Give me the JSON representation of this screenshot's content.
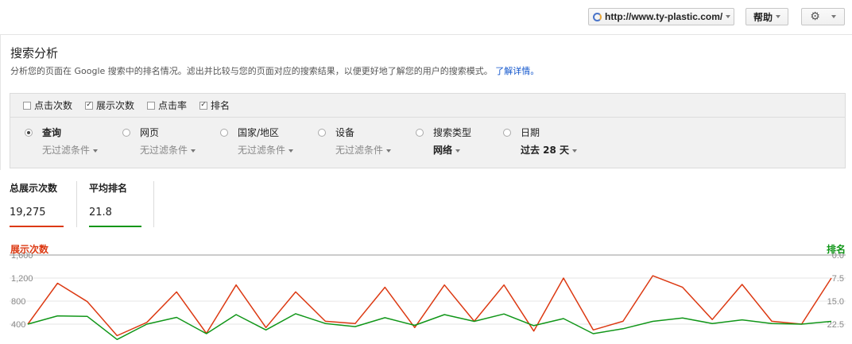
{
  "header": {
    "site": "http://www.ty-plastic.com/",
    "help_label": "帮助",
    "settings_icon": "gear-icon"
  },
  "page": {
    "title": "搜索分析",
    "description": "分析您的页面在 Google 搜索中的排名情况。滤出并比较与您的页面对应的搜索结果，以便更好地了解您的用户的搜索模式。",
    "learn_more": "了解详情。"
  },
  "metrics": [
    {
      "label": "点击次数",
      "checked": false
    },
    {
      "label": "展示次数",
      "checked": true
    },
    {
      "label": "点击率",
      "checked": false
    },
    {
      "label": "排名",
      "checked": true
    }
  ],
  "dimensions": [
    {
      "label": "查询",
      "value": "无过滤条件",
      "selected": true
    },
    {
      "label": "网页",
      "value": "无过滤条件",
      "selected": false
    },
    {
      "label": "国家/地区",
      "value": "无过滤条件",
      "selected": false
    },
    {
      "label": "设备",
      "value": "无过滤条件",
      "selected": false
    },
    {
      "label": "搜索类型",
      "value": "网络",
      "selected": false
    },
    {
      "label": "日期",
      "value": "过去 28 天",
      "selected": false
    }
  ],
  "totals": [
    {
      "label": "总展示次数",
      "value": "19,275",
      "color": "#dc3912"
    },
    {
      "label": "平均排名",
      "value": "21.8",
      "color": "#109618"
    }
  ],
  "chart_data": {
    "type": "line",
    "left_axis_label": "展示次数",
    "right_axis_label": "排名",
    "left_ticks": [
      "1,600",
      "1,200",
      "800",
      "400"
    ],
    "right_ticks": [
      "0.0",
      "7.5",
      "15.0",
      "22.5"
    ],
    "left_ylim": [
      400,
      1600
    ],
    "right_ylim": [
      0,
      22.5
    ],
    "series": [
      {
        "name": "展示次数",
        "axis": "left",
        "color": "#dc3912",
        "values": [
          400,
          1110,
          790,
          200,
          430,
          960,
          240,
          1080,
          340,
          960,
          450,
          410,
          1040,
          340,
          1080,
          450,
          1080,
          280,
          1200,
          300,
          450,
          1240,
          1040,
          480,
          1090,
          450,
          400,
          1200
        ]
      },
      {
        "name": "排名",
        "axis": "right",
        "color": "#109618",
        "values": [
          22.5,
          19.8,
          20.0,
          27.5,
          22.5,
          20.3,
          25.6,
          19.4,
          24.4,
          19.1,
          22.3,
          23.3,
          20.4,
          22.9,
          19.4,
          21.6,
          19.2,
          23.0,
          20.7,
          25.6,
          24.0,
          21.6,
          20.5,
          22.3,
          21.1,
          22.3,
          22.5,
          21.6
        ]
      }
    ]
  }
}
